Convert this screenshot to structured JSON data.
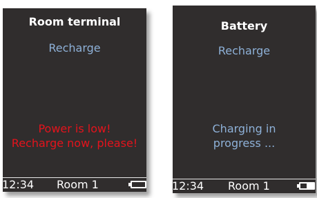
{
  "colors": {
    "screen_background": "#302d2d",
    "title_text": "#ffffff",
    "recharge_text": "#8eb1d8",
    "warning_text": "#e4131c",
    "charging_text": "#8eb1d8",
    "status_text": "#ffffff"
  },
  "left_screen": {
    "title": "Room terminal",
    "subtitle": "Recharge",
    "message_lines": [
      "Power is low!",
      "Recharge now, please!"
    ],
    "status_bar": {
      "time": "12:34",
      "room": "Room 1",
      "battery_icon": "battery-empty-icon",
      "battery_level": 0
    }
  },
  "right_screen": {
    "title": "Battery",
    "subtitle": "Recharge",
    "message_lines": [
      "Charging in",
      "progress ..."
    ],
    "status_bar": {
      "time": "12:34",
      "room": "Room 1",
      "battery_icon": "battery-charging-icon",
      "battery_level": 0.55
    }
  }
}
